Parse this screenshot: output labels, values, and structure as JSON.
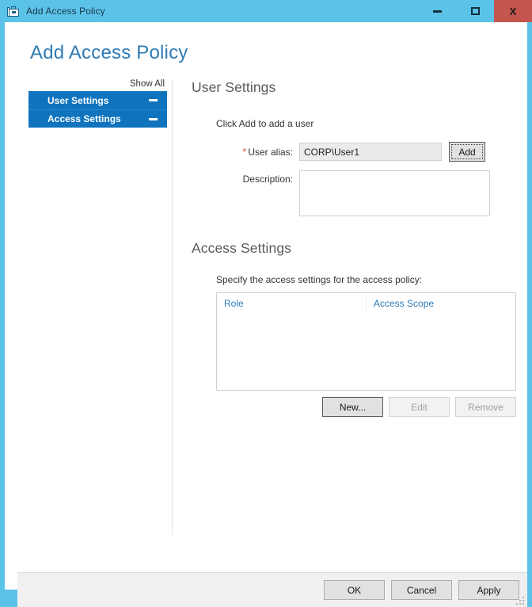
{
  "window": {
    "title": "Add Access Policy",
    "icon": "toolbox-icon",
    "controls": {
      "minimize": "–",
      "maximize": "□",
      "close": "X"
    },
    "frame_color": "#5CC3E8",
    "close_color": "#C4564F"
  },
  "page": {
    "title": "Add Access Policy",
    "title_color": "#2E7BB5"
  },
  "nav": {
    "show_all": "Show All",
    "items": [
      {
        "label": "User Settings",
        "toggle": "collapse"
      },
      {
        "label": "Access Settings",
        "toggle": "collapse"
      }
    ],
    "item_color": "#0F73BD"
  },
  "user_settings": {
    "heading": "User Settings",
    "instruction": "Click Add to add a user",
    "alias": {
      "required_marker": "*",
      "label": "User alias:",
      "value": "CORP\\User1",
      "placeholder": ""
    },
    "add_button": "Add",
    "description": {
      "label": "Description:",
      "value": "",
      "placeholder": ""
    }
  },
  "access_settings": {
    "heading": "Access Settings",
    "instruction": "Specify the access settings for the access policy:",
    "table": {
      "columns": [
        "Role",
        "Access Scope"
      ],
      "rows": []
    },
    "buttons": [
      {
        "label": "New...",
        "enabled": true
      },
      {
        "label": "Edit",
        "enabled": false
      },
      {
        "label": "Remove",
        "enabled": false
      }
    ]
  },
  "footer": {
    "buttons": [
      {
        "label": "OK"
      },
      {
        "label": "Cancel"
      },
      {
        "label": "Apply"
      }
    ]
  }
}
